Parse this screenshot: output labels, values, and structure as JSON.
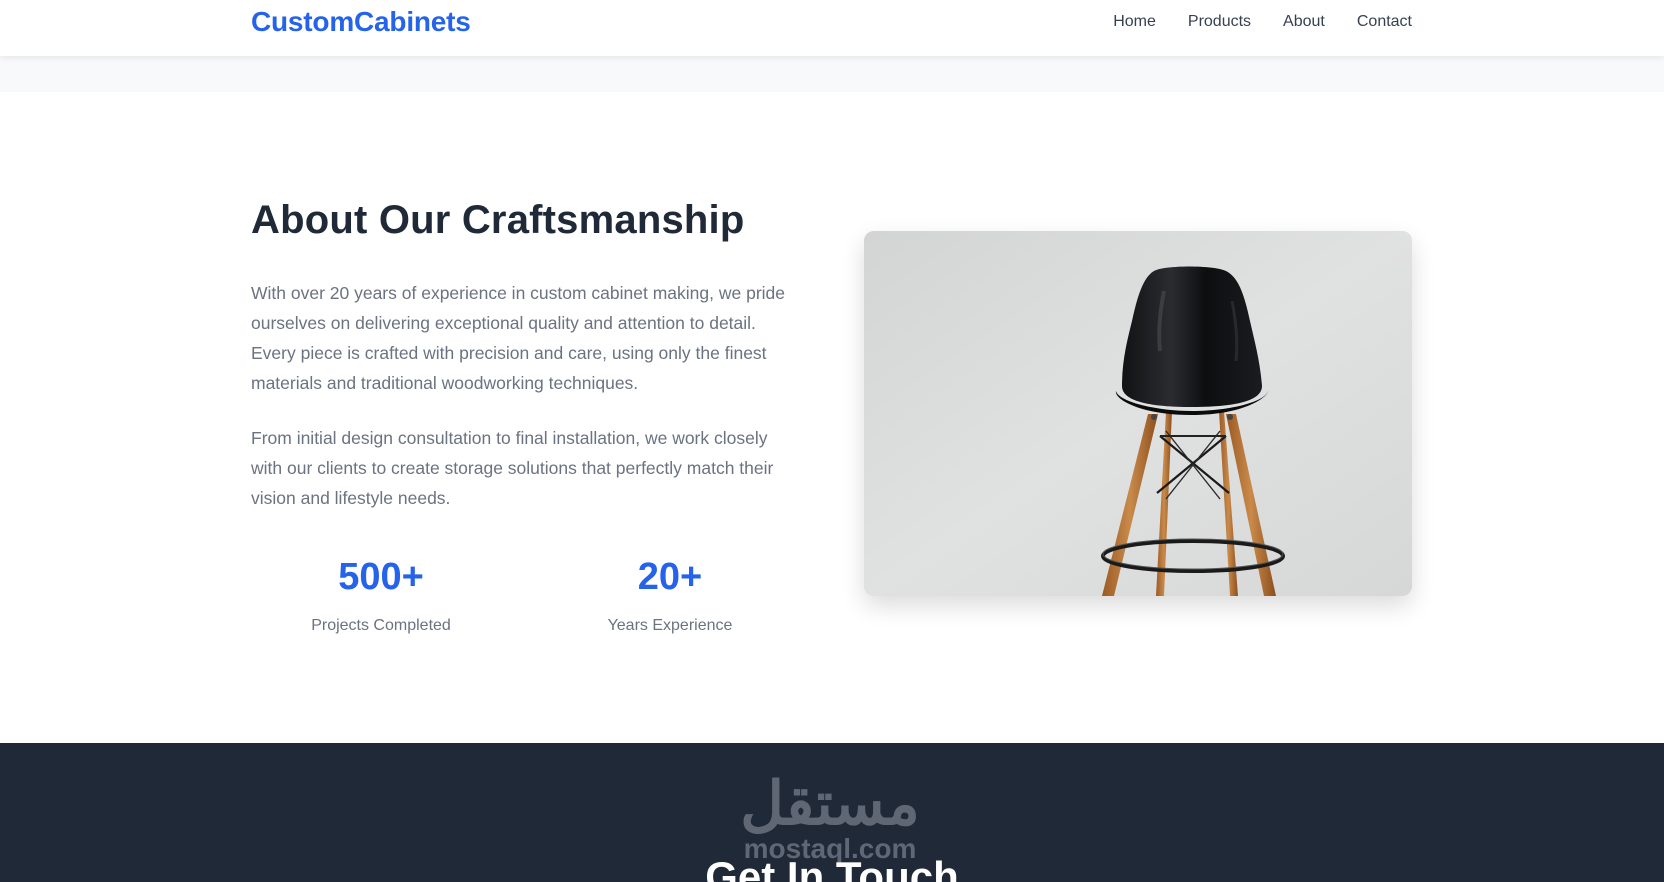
{
  "nav": {
    "brand": "CustomCabinets",
    "links": [
      "Home",
      "Products",
      "About",
      "Contact"
    ]
  },
  "about": {
    "title": "About Our Craftsmanship",
    "paragraphs": [
      "With over 20 years of experience in custom cabinet making, we pride ourselves on delivering exceptional quality and attention to detail. Every piece is crafted with precision and care, using only the finest materials and traditional woodworking techniques.",
      "From initial design consultation to final installation, we work closely with our clients to create storage solutions that perfectly match their vision and lifestyle needs."
    ],
    "stats": [
      {
        "value": "500+",
        "label": "Projects Completed"
      },
      {
        "value": "20+",
        "label": "Years Experience"
      }
    ],
    "image_subject": "black chair with wooden legs"
  },
  "contact": {
    "title": "Get In Touch"
  },
  "watermark": {
    "arabic": "مستقل",
    "latin": "mostaql.com"
  },
  "colors": {
    "brand": "#2563eb",
    "heading": "#1f2937",
    "body_text": "#6b7280",
    "footer_bg": "#1f2937"
  }
}
